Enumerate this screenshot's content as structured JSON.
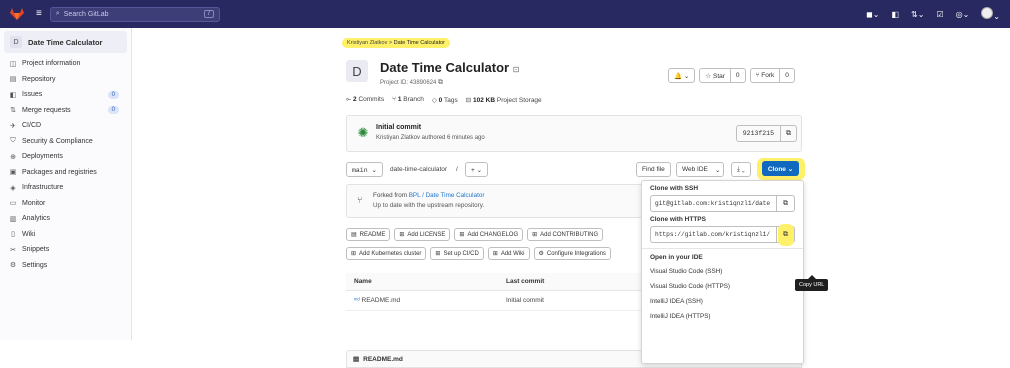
{
  "topbar": {
    "search_placeholder": "Search GitLab",
    "search_key": "/"
  },
  "sidebar": {
    "project_letter": "D",
    "project_name": "Date Time Calculator",
    "items": [
      {
        "label": "Project information",
        "icon": "info-icon",
        "glyph": "◫"
      },
      {
        "label": "Repository",
        "icon": "doc-icon",
        "glyph": "▤"
      },
      {
        "label": "Issues",
        "icon": "issues-icon",
        "glyph": "◧",
        "badge": "0"
      },
      {
        "label": "Merge requests",
        "icon": "merge-icon",
        "glyph": "⇅",
        "badge": "0"
      },
      {
        "label": "CI/CD",
        "icon": "rocket-icon",
        "glyph": "✈"
      },
      {
        "label": "Security & Compliance",
        "icon": "shield-icon",
        "glyph": "⛉"
      },
      {
        "label": "Deployments",
        "icon": "deploy-icon",
        "glyph": "⊕"
      },
      {
        "label": "Packages and registries",
        "icon": "package-icon",
        "glyph": "▣"
      },
      {
        "label": "Infrastructure",
        "icon": "cloud-icon",
        "glyph": "◈"
      },
      {
        "label": "Monitor",
        "icon": "monitor-icon",
        "glyph": "▭"
      },
      {
        "label": "Analytics",
        "icon": "chart-icon",
        "glyph": "▥"
      },
      {
        "label": "Wiki",
        "icon": "book-icon",
        "glyph": "▯"
      },
      {
        "label": "Snippets",
        "icon": "scissors-icon",
        "glyph": "✂"
      },
      {
        "label": "Settings",
        "icon": "gear-icon",
        "glyph": "⚙"
      }
    ]
  },
  "breadcrumb": {
    "owner": "Kristiyan Zlatkov",
    "sep": ">",
    "current": "Date Time Calculator"
  },
  "project": {
    "avatar_letter": "D",
    "title": "Date Time Calculator",
    "id_label": "Project ID: 43890624",
    "notify": "🔔 ⌄",
    "star_label": "☆ Star",
    "star_count": "0",
    "fork_label": "⑂ Fork",
    "fork_count": "0"
  },
  "stats": {
    "commits_n": "2",
    "commits_label": "Commits",
    "branch_n": "1",
    "branch_label": "Branch",
    "tags_n": "0",
    "tags_label": "Tags",
    "storage_n": "102 KB",
    "storage_label": "Project Storage"
  },
  "commit": {
    "message": "Initial commit",
    "meta": "Kristiyan Zlatkov authored 6 minutes ago",
    "sha": "9213f215"
  },
  "toolbar": {
    "branch": "main ⌄",
    "path": "date-time-calculator",
    "path_sep": "/",
    "add": "+ ⌄",
    "find_file": "Find file",
    "web_ide": "Web IDE",
    "web_ide_caret": "⌄",
    "download": "⤓ ⌄",
    "clone": "Clone ⌄",
    "clone_color": "#1068bf",
    "highlight_color": "#fff06a"
  },
  "fork_box": {
    "prefix": "Forked from ",
    "link": "BPL / Date Time Calculator",
    "status": "Up to date with the upstream repository."
  },
  "chips_row1": [
    "README",
    "Add LICENSE",
    "Add CHANGELOG",
    "Add CONTRIBUTING"
  ],
  "chips_row2": [
    "Add Kubernetes cluster",
    "Set up CI/CD",
    "Add Wiki",
    "Configure Integrations"
  ],
  "file_table": {
    "headers": [
      "Name",
      "Last commit"
    ],
    "rows": [
      {
        "name": "README.md",
        "commit": "Initial commit"
      }
    ]
  },
  "readme_label": "README.md",
  "clone_menu": {
    "ssh_title": "Clone with SSH",
    "ssh_url": "git@gitlab.com:kristiqnzl1/date",
    "https_title": "Clone with HTTPS",
    "https_url": "https://gitlab.com/kristiqnzl1/",
    "ide_title": "Open in your IDE",
    "ide_options": [
      "Visual Studio Code (SSH)",
      "Visual Studio Code (HTTPS)",
      "IntelliJ IDEA (SSH)",
      "IntelliJ IDEA (HTTPS)"
    ],
    "tooltip": "Copy URL"
  }
}
